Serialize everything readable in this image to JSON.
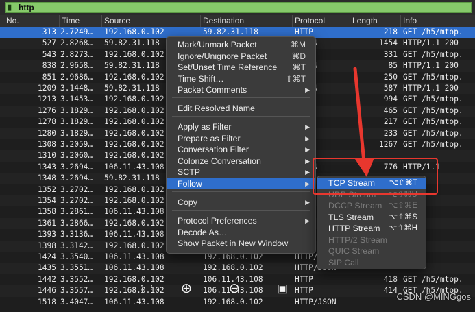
{
  "filter": {
    "value": "http"
  },
  "columns": [
    "No.",
    "Time",
    "Source",
    "Destination",
    "Protocol",
    "Length",
    "Info"
  ],
  "rows": [
    {
      "no": "313",
      "time": "2.7249…",
      "src": "192.168.0.102",
      "dst": "59.82.31.118",
      "proto": "HTTP",
      "len": "218",
      "info": "GET /h5/mtop."
    },
    {
      "no": "527",
      "time": "2.8268…",
      "src": "59.82.31.118",
      "dst": "",
      "proto": "/JSON",
      "len": "1454",
      "info": "HTTP/1.1 200"
    },
    {
      "no": "543",
      "time": "2.8273…",
      "src": "192.168.0.102",
      "dst": "",
      "proto": "",
      "len": "331",
      "info": "GET /h5/mtop."
    },
    {
      "no": "838",
      "time": "2.9658…",
      "src": "59.82.31.118",
      "dst": "",
      "proto": "/JSON",
      "len": "85",
      "info": "HTTP/1.1 200"
    },
    {
      "no": "851",
      "time": "2.9686…",
      "src": "192.168.0.102",
      "dst": "",
      "proto": "",
      "len": "250",
      "info": "GET /h5/mtop."
    },
    {
      "no": "1209",
      "time": "3.1448…",
      "src": "59.82.31.118",
      "dst": "",
      "proto": "/JSON",
      "len": "587",
      "info": "HTTP/1.1 200"
    },
    {
      "no": "1213",
      "time": "3.1453…",
      "src": "192.168.0.102",
      "dst": "",
      "proto": "",
      "len": "994",
      "info": "GET /h5/mtop."
    },
    {
      "no": "1276",
      "time": "3.1829…",
      "src": "192.168.0.102",
      "dst": "",
      "proto": "",
      "len": "465",
      "info": "GET /h5/mtop."
    },
    {
      "no": "1278",
      "time": "3.1829…",
      "src": "192.168.0.102",
      "dst": "",
      "proto": "",
      "len": "217",
      "info": "GET /h5/mtop."
    },
    {
      "no": "1280",
      "time": "3.1829…",
      "src": "192.168.0.102",
      "dst": "",
      "proto": "",
      "len": "233",
      "info": "GET /h5/mtop."
    },
    {
      "no": "1308",
      "time": "3.2059…",
      "src": "192.168.0.102",
      "dst": "",
      "proto": "",
      "len": "1267",
      "info": "GET /h5/mtop."
    },
    {
      "no": "1310",
      "time": "3.2060…",
      "src": "192.168.0.102",
      "dst": "",
      "proto": "",
      "len": "",
      "info": ""
    },
    {
      "no": "1343",
      "time": "3.2694…",
      "src": "106.11.43.108",
      "dst": "",
      "proto": "/JSON",
      "len": "776",
      "info": "HTTP/1.1"
    },
    {
      "no": "1348",
      "time": "3.2694…",
      "src": "59.82.31.118",
      "dst": "",
      "proto": "",
      "len": "",
      "info": ""
    },
    {
      "no": "1352",
      "time": "3.2702…",
      "src": "192.168.0.102",
      "dst": "",
      "proto": "",
      "len": "",
      "info": ""
    },
    {
      "no": "1354",
      "time": "3.2702…",
      "src": "192.168.0.102",
      "dst": "",
      "proto": "",
      "len": "",
      "info": ""
    },
    {
      "no": "1358",
      "time": "3.2861…",
      "src": "106.11.43.108",
      "dst": "",
      "proto": "",
      "len": "",
      "info": ""
    },
    {
      "no": "1361",
      "time": "3.2866…",
      "src": "192.168.0.102",
      "dst": "",
      "proto": "",
      "len": "",
      "info": ""
    },
    {
      "no": "1393",
      "time": "3.3136…",
      "src": "106.11.43.108",
      "dst": "",
      "proto": "",
      "len": "",
      "info": ""
    },
    {
      "no": "1398",
      "time": "3.3142…",
      "src": "192.168.0.102",
      "dst": "",
      "proto": "",
      "len": "",
      "info": ""
    },
    {
      "no": "1424",
      "time": "3.3540…",
      "src": "106.11.43.108",
      "dst": "192.168.0.102",
      "proto": "HTTP/",
      "len": "",
      "info": ""
    },
    {
      "no": "1435",
      "time": "3.3551…",
      "src": "106.11.43.108",
      "dst": "192.168.0.102",
      "proto": "HTTP/JSON",
      "len": "",
      "info": ""
    },
    {
      "no": "1442",
      "time": "3.3552…",
      "src": "192.168.0.102",
      "dst": "106.11.43.108",
      "proto": "HTTP",
      "len": "418",
      "info": "GET /h5/mtop."
    },
    {
      "no": "1446",
      "time": "3.3557…",
      "src": "192.168.0.102",
      "dst": "106.11.43.108",
      "proto": "HTTP",
      "len": "414",
      "info": "GET /h5/mtop."
    },
    {
      "no": "1518",
      "time": "3.4047…",
      "src": "106.11.43.108",
      "dst": "192.168.0.102",
      "proto": "HTTP/JSON",
      "len": "",
      "info": ""
    }
  ],
  "context_menu": {
    "items": [
      {
        "label": "Mark/Unmark Packet",
        "shortcut": "⌘M"
      },
      {
        "label": "Ignore/Unignore Packet",
        "shortcut": "⌘D"
      },
      {
        "label": "Set/Unset Time Reference",
        "shortcut": "⌘T"
      },
      {
        "label": "Time Shift…",
        "shortcut": "⇧⌘T"
      },
      {
        "label": "Packet Comments",
        "shortcut": ""
      },
      {
        "label": "Edit Resolved Name",
        "shortcut": ""
      },
      {
        "label": "Apply as Filter",
        "shortcut": ""
      },
      {
        "label": "Prepare as Filter",
        "shortcut": ""
      },
      {
        "label": "Conversation Filter",
        "shortcut": ""
      },
      {
        "label": "Colorize Conversation",
        "shortcut": ""
      },
      {
        "label": "SCTP",
        "shortcut": ""
      },
      {
        "label": "Follow",
        "shortcut": ""
      },
      {
        "label": "Copy",
        "shortcut": ""
      },
      {
        "label": "Protocol Preferences",
        "shortcut": ""
      },
      {
        "label": "Decode As…",
        "shortcut": ""
      },
      {
        "label": "Show Packet in New Window",
        "shortcut": ""
      }
    ]
  },
  "follow_submenu": {
    "items": [
      {
        "label": "TCP Stream",
        "shortcut": "⌥⇧⌘T"
      },
      {
        "label": "UDP Stream",
        "shortcut": "⌥⇧⌘U"
      },
      {
        "label": "DCCP Stream",
        "shortcut": "⌥⇧⌘E"
      },
      {
        "label": "TLS Stream",
        "shortcut": "⌥⇧⌘S"
      },
      {
        "label": "HTTP Stream",
        "shortcut": "⌥⇧⌘H"
      },
      {
        "label": "HTTP/2 Stream",
        "shortcut": ""
      },
      {
        "label": "QUIC Stream",
        "shortcut": ""
      },
      {
        "label": "SIP Call",
        "shortcut": ""
      }
    ]
  },
  "colors": {
    "selection": "#2f6ecb",
    "filter_ok": "#86c96a",
    "annotation": "#e8372e"
  },
  "watermark": "CSDN @MINGgos"
}
